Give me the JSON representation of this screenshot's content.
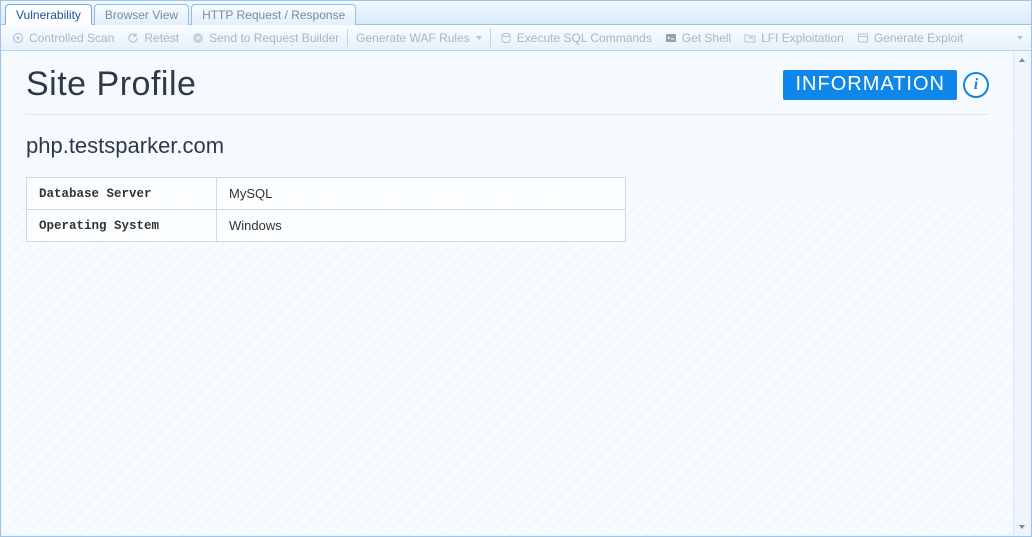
{
  "tabs": [
    {
      "label": "Vulnerability",
      "active": true
    },
    {
      "label": "Browser View",
      "active": false
    },
    {
      "label": "HTTP Request / Response",
      "active": false
    }
  ],
  "toolbar": {
    "controlled_scan": "Controlled Scan",
    "retest": "Retest",
    "send_to_request_builder": "Send to Request Builder",
    "generate_waf_rules": "Generate WAF Rules",
    "execute_sql_commands": "Execute SQL Commands",
    "get_shell": "Get Shell",
    "lfi_exploitation": "LFI Exploitation",
    "generate_exploit": "Generate Exploit"
  },
  "page": {
    "title": "Site Profile",
    "severity_label": "INFORMATION",
    "host": "php.testsparker.com"
  },
  "properties": [
    {
      "name": "Database Server",
      "value": "MySQL"
    },
    {
      "name": "Operating System",
      "value": "Windows"
    }
  ]
}
